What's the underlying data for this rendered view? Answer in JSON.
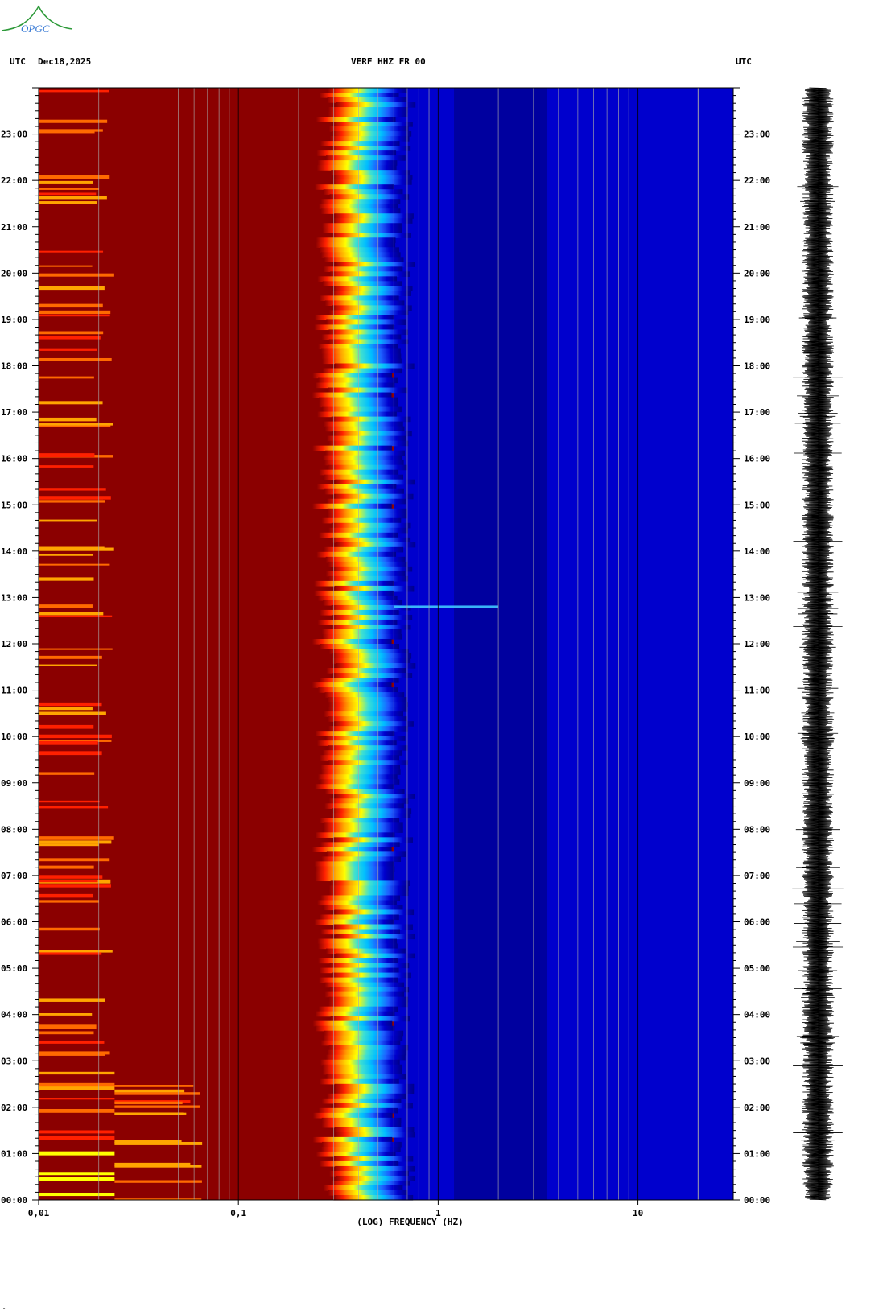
{
  "logo": {
    "text": "OPGC",
    "colors": {
      "text": "#3a7bd5",
      "curve": "#2e9a3a"
    }
  },
  "header": {
    "left_tz": "UTC",
    "date": "Dec18,2025",
    "station": "VERF HHZ FR 00",
    "right_tz": "UTC"
  },
  "chart_data": {
    "type": "heatmap",
    "title": "VERF HHZ FR 00",
    "xlabel": "(LOG) FREQUENCY (HZ)",
    "ylabel": "",
    "x_scale": "log",
    "xlim": [
      0.01,
      30
    ],
    "x_tick_labels": [
      {
        "value": 0.01,
        "label": "0,01"
      },
      {
        "value": 0.1,
        "label": "0,1"
      },
      {
        "value": 1,
        "label": "1"
      },
      {
        "value": 10,
        "label": "10"
      }
    ],
    "y_ticks": [
      "00:00",
      "01:00",
      "02:00",
      "03:00",
      "04:00",
      "05:00",
      "06:00",
      "07:00",
      "08:00",
      "09:00",
      "10:00",
      "11:00",
      "12:00",
      "13:00",
      "14:00",
      "15:00",
      "16:00",
      "17:00",
      "18:00",
      "19:00",
      "20:00",
      "21:00",
      "22:00",
      "23:00"
    ],
    "ylim_hours": [
      0,
      24
    ],
    "grid": true,
    "colormap": [
      "#00008b",
      "#0000cd",
      "#1e5fff",
      "#00bfff",
      "#40e0d0",
      "#ffff00",
      "#ffa500",
      "#ff2000",
      "#8b0000"
    ],
    "background_color": "#8b0000",
    "transition_freq_hz": [
      0.3,
      0.6
    ],
    "notable_event": {
      "hour": 12.8,
      "freq_range_hz": [
        0.6,
        2.0
      ]
    },
    "seismogram_color": "#000000"
  }
}
